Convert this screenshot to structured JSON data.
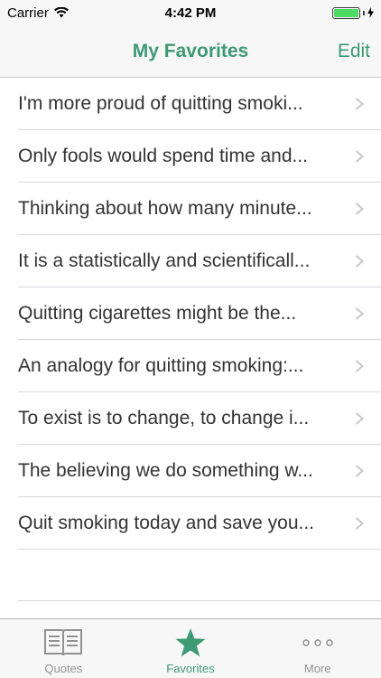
{
  "status_bar": {
    "carrier": "Carrier",
    "time": "4:42 PM",
    "battery_level": 1.0,
    "battery_color": "#4cd964"
  },
  "nav": {
    "title": "My Favorites",
    "edit_label": "Edit"
  },
  "accent_color": "#3d9a73",
  "favorites": [
    "I'm more proud of quitting smoki...",
    "Only fools would spend time and...",
    "Thinking about how many minute...",
    "It is a statistically and scientificall...",
    "Quitting cigarettes might be the...",
    "An analogy for quitting smoking:...",
    "To exist is to change, to change i...",
    "The believing we do something w...",
    "Quit smoking today and save you..."
  ],
  "tabs": [
    {
      "label": "Quotes",
      "icon": "book-icon",
      "active": false
    },
    {
      "label": "Favorites",
      "icon": "star-icon",
      "active": true
    },
    {
      "label": "More",
      "icon": "more-dots-icon",
      "active": false
    }
  ]
}
